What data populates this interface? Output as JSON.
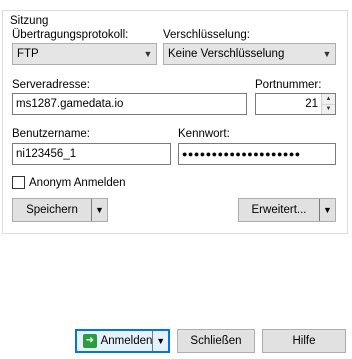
{
  "group_title": "Sitzung",
  "protocol": {
    "label": "Übertragungsprotokoll:",
    "value": "FTP"
  },
  "encryption": {
    "label": "Verschlüsselung:",
    "value": "Keine Verschlüsselung"
  },
  "host": {
    "label": "Serveradresse:",
    "value": "ms1287.gamedata.io"
  },
  "port": {
    "label": "Portnummer:",
    "value": "21"
  },
  "username": {
    "label": "Benutzername:",
    "value": "ni123456_1"
  },
  "password": {
    "label": "Kennwort:",
    "value": "●●●●●●●●●●●●●●●●●●●●"
  },
  "anonymous": {
    "label": "Anonym Anmelden",
    "checked": false
  },
  "buttons": {
    "save": "Speichern",
    "advanced": "Erweitert...",
    "login": "Anmelden",
    "close": "Schließen",
    "help": "Hilfe"
  },
  "colors": {
    "accent": "#0078d7",
    "login_icon": "#2a9d3f"
  }
}
